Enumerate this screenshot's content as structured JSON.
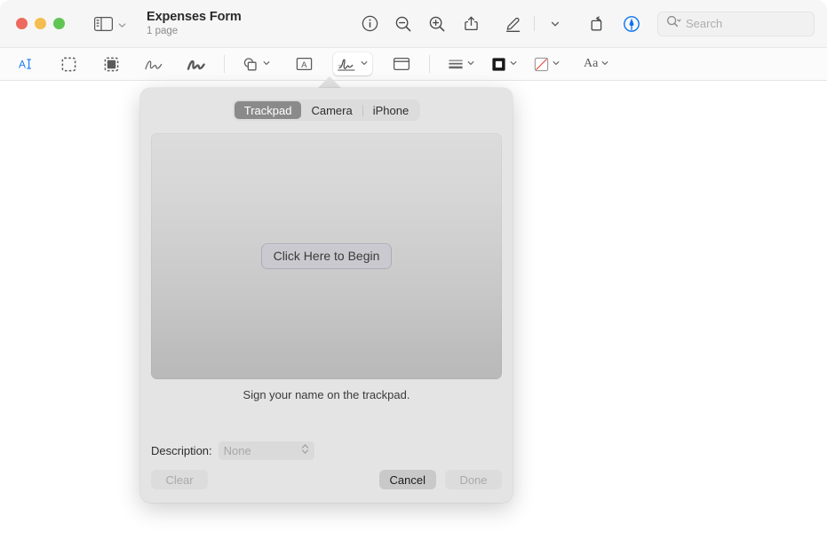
{
  "window": {
    "titlebar": {
      "traffic_lights": [
        {
          "name": "close",
          "color": "#ed6a5e"
        },
        {
          "name": "minimize",
          "color": "#f5bd4f"
        },
        {
          "name": "zoom",
          "color": "#61c554"
        }
      ],
      "sidebar_icon": "sidebar-icon",
      "sidebar_chevron": "chevron-down-icon",
      "doc_title": "Expenses Form",
      "doc_subtitle": "1 page",
      "actions": [
        {
          "name": "info-button",
          "icon": "info-circle-icon"
        },
        {
          "name": "zoom-out-button",
          "icon": "magnifier-minus-icon"
        },
        {
          "name": "zoom-in-button",
          "icon": "magnifier-plus-icon"
        },
        {
          "name": "share-button",
          "icon": "share-icon"
        },
        {
          "name": "markup-button",
          "icon": "pencil-markup-icon"
        },
        {
          "name": "markup-options-button",
          "icon": "chevron-down-icon"
        },
        {
          "name": "rotate-button",
          "icon": "rotate-left-icon"
        },
        {
          "name": "annotate-button",
          "icon": "annotate-pen-circle-icon"
        }
      ],
      "search": {
        "placeholder": "Search",
        "icon": "search-icon",
        "chevron": "chevron-down-icon"
      }
    },
    "markupbar": {
      "tools": [
        {
          "name": "text-selection-tool",
          "icon": "text-select-icon",
          "active": false
        },
        {
          "name": "rectangular-selection-tool",
          "icon": "dashed-rect-icon",
          "active": false
        },
        {
          "name": "instant-alpha-tool",
          "icon": "instant-alpha-icon",
          "active": false
        },
        {
          "name": "sketch-tool",
          "icon": "sketch-icon",
          "active": false
        },
        {
          "name": "draw-tool",
          "icon": "draw-squiggle-icon",
          "active": false
        },
        {
          "name": "shapes-tool",
          "icon": "shapes-icon",
          "active": false
        },
        {
          "name": "text-tool",
          "icon": "text-box-icon",
          "active": false
        },
        {
          "name": "sign-tool",
          "icon": "signature-icon",
          "active": true
        },
        {
          "name": "note-tool",
          "icon": "note-icon",
          "active": false
        },
        {
          "name": "border-style-tool",
          "icon": "border-style-icon",
          "active": false
        },
        {
          "name": "border-color-tool",
          "icon": "border-color-icon",
          "active": false
        },
        {
          "name": "fill-color-tool",
          "icon": "fill-color-none-icon",
          "active": false
        },
        {
          "name": "font-tool",
          "icon": "font-aa-icon",
          "label": "Aa",
          "active": false
        }
      ]
    }
  },
  "popover": {
    "tabs": [
      {
        "label": "Trackpad",
        "selected": true
      },
      {
        "label": "Camera",
        "selected": false
      },
      {
        "label": "iPhone",
        "selected": false
      }
    ],
    "pad": {
      "begin_button": "Click Here to Begin"
    },
    "hint": "Sign your name on the trackpad.",
    "description": {
      "label": "Description:",
      "value": "None",
      "options": [
        "None"
      ],
      "enabled": false
    },
    "buttons": {
      "clear": {
        "label": "Clear",
        "enabled": false
      },
      "cancel": {
        "label": "Cancel",
        "enabled": true
      },
      "done": {
        "label": "Done",
        "enabled": false
      }
    }
  },
  "colors": {
    "popover_bg": "#e4e4e4",
    "selected_tab": "#8a8a8a",
    "accent_blue": "#0a74f0"
  }
}
